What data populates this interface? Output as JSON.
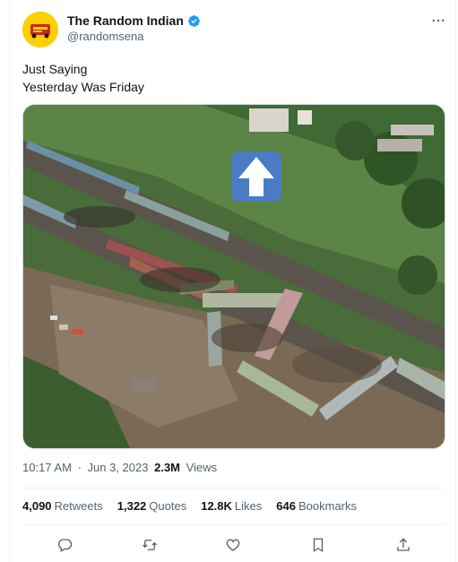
{
  "author": {
    "display_name": "The Random Indian",
    "handle": "@randomsena",
    "verified": true,
    "avatar_colors": {
      "bg": "#fad000",
      "fg": "#c62828"
    }
  },
  "tweet": {
    "lines": [
      "Just Saying",
      "Yesterday Was Friday"
    ]
  },
  "media": {
    "description_icon": "aerial-photo-train-derailment",
    "arrow_icon": "up-arrow-icon"
  },
  "meta": {
    "time": "10:17 AM",
    "separator": "·",
    "date": "Jun 3, 2023",
    "views_count": "2.3M",
    "views_label": "Views"
  },
  "stats": {
    "retweets": {
      "count": "4,090",
      "label": "Retweets"
    },
    "quotes": {
      "count": "1,322",
      "label": "Quotes"
    },
    "likes": {
      "count": "12.8K",
      "label": "Likes"
    },
    "bookmarks": {
      "count": "646",
      "label": "Bookmarks"
    }
  },
  "colors": {
    "text": "#0f1419",
    "secondary": "#536471",
    "border": "#eff3f4",
    "verified": "#1d9bf0"
  }
}
